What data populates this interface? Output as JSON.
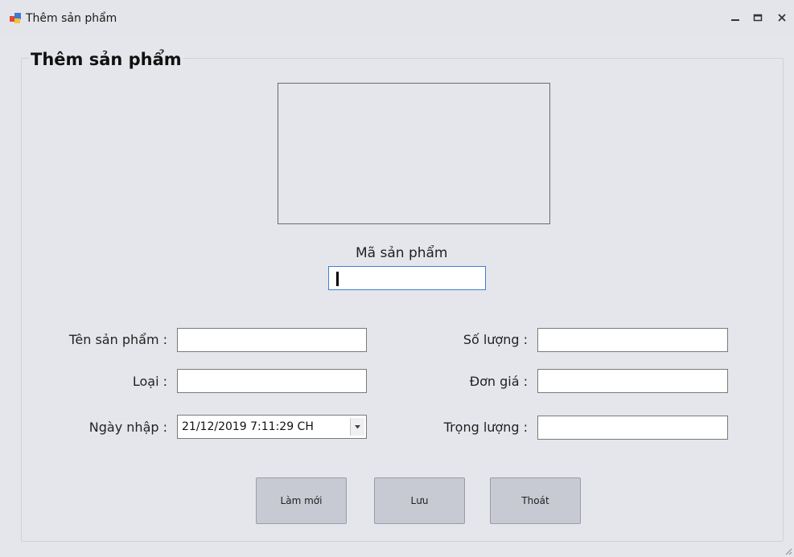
{
  "window": {
    "title": "Thêm sản phẩm",
    "controls": {
      "minimize": "–",
      "maximize": "☐",
      "close": "✕"
    }
  },
  "form": {
    "group_title": "Thêm sản phẩm",
    "product_code": {
      "label": "Mã sản phẩm",
      "value": ""
    },
    "fields": {
      "product_name": {
        "label": "Tên sản phẩm :",
        "value": ""
      },
      "category": {
        "label": "Loại :",
        "value": ""
      },
      "import_date": {
        "label": "Ngày nhập :",
        "value": "21/12/2019 7:11:29 CH"
      },
      "quantity": {
        "label": "Số lượng :",
        "value": ""
      },
      "unit_price": {
        "label": "Đơn giá :",
        "value": ""
      },
      "weight": {
        "label": "Trọng lượng :",
        "value": ""
      }
    },
    "buttons": {
      "refresh": "Làm mới",
      "save": "Lưu",
      "exit": "Thoát"
    }
  },
  "colors": {
    "window_bg": "#e5e6ec",
    "button_bg": "#c8cad3",
    "focus_border": "#3d7fd1"
  }
}
